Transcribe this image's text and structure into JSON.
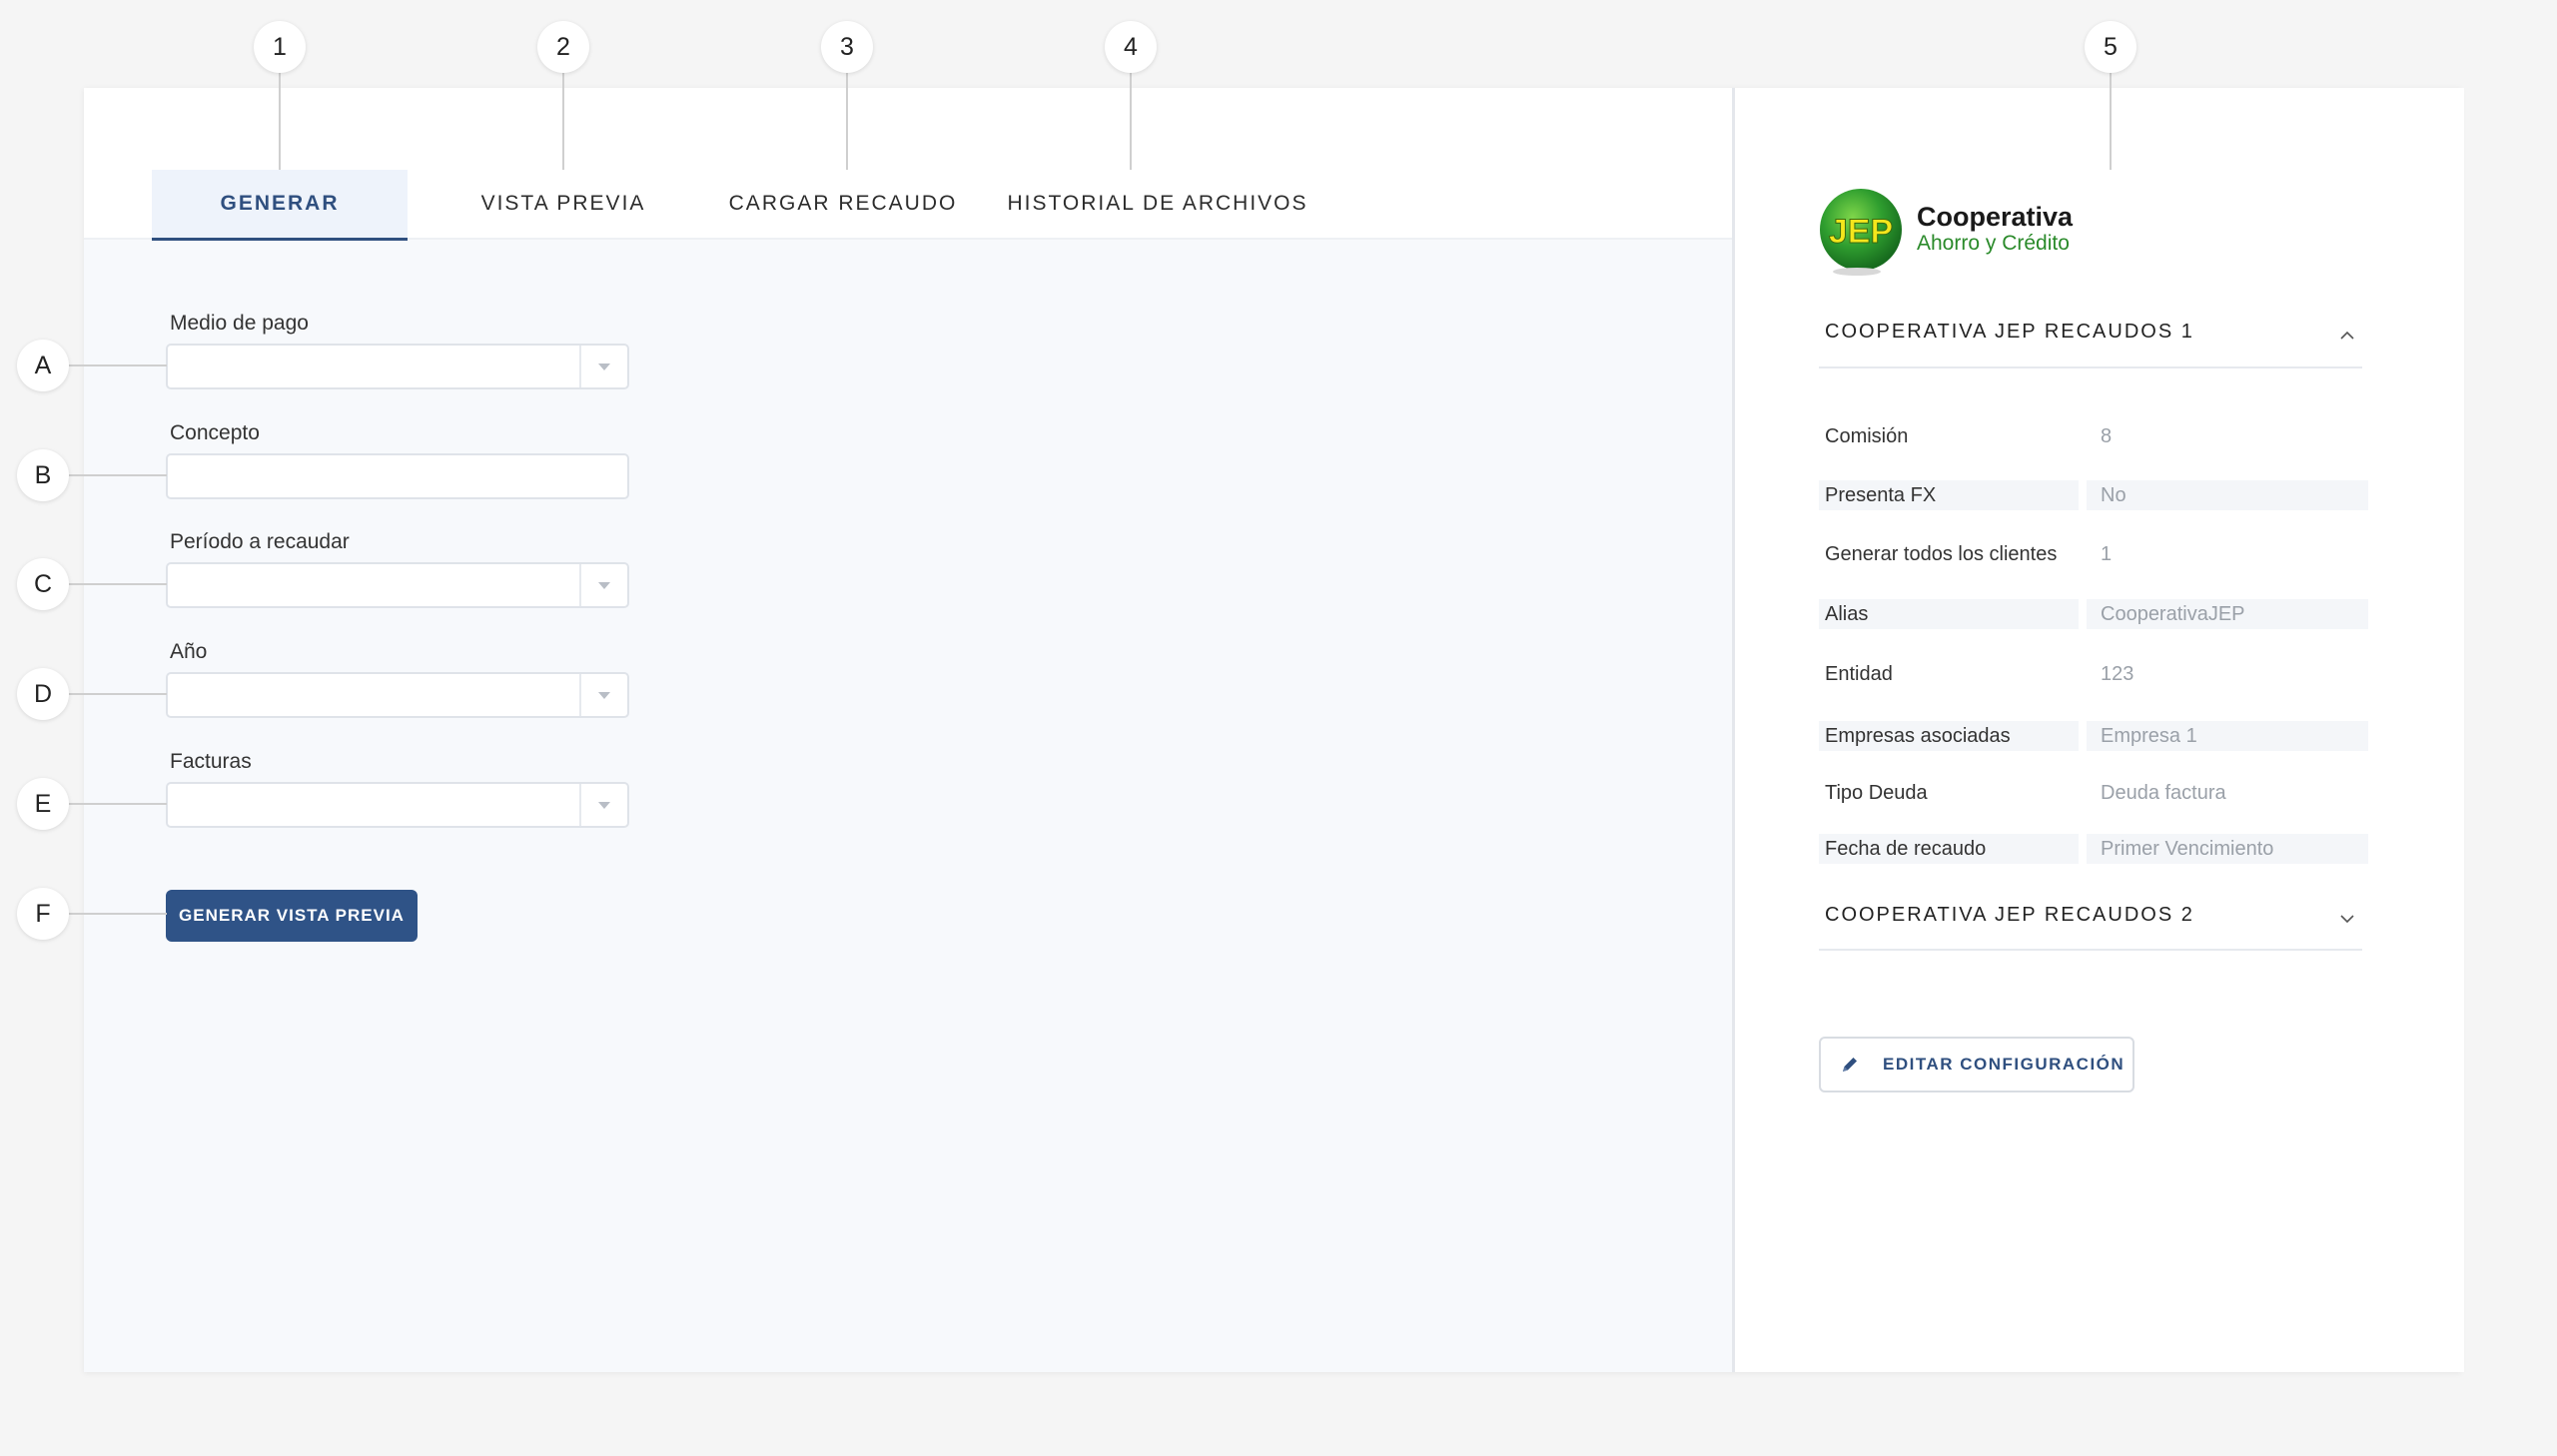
{
  "callouts": {
    "top": [
      "1",
      "2",
      "3",
      "4",
      "5"
    ],
    "left": [
      "A",
      "B",
      "C",
      "D",
      "E",
      "F"
    ]
  },
  "tabs": [
    {
      "label": "GENERAR",
      "active": true
    },
    {
      "label": "VISTA PREVIA",
      "active": false
    },
    {
      "label": "CARGAR RECAUDO",
      "active": false
    },
    {
      "label": "HISTORIAL DE ARCHIVOS",
      "active": false
    }
  ],
  "form": {
    "medio_pago": {
      "label": "Medio de pago",
      "value": ""
    },
    "concepto": {
      "label": "Concepto",
      "value": ""
    },
    "periodo": {
      "label": "Período a recaudar",
      "value": ""
    },
    "anio": {
      "label": "Año",
      "value": ""
    },
    "facturas": {
      "label": "Facturas",
      "value": ""
    },
    "submit_label": "GENERAR VISTA PREVIA"
  },
  "logo": {
    "mark": "JEP",
    "line1": "Cooperativa",
    "line2": "Ahorro y Crédito"
  },
  "config": {
    "section1": {
      "title": "COOPERATIVA JEP RECAUDOS 1",
      "expanded": true,
      "rows": [
        {
          "key": "Comisión",
          "value": "8"
        },
        {
          "key": "Presenta FX",
          "value": "No"
        },
        {
          "key": "Generar todos los clientes",
          "value": "1"
        },
        {
          "key": "Alias",
          "value": "CooperativaJEP"
        },
        {
          "key": "Entidad",
          "value": "123"
        },
        {
          "key": "Empresas asociadas",
          "value": "Empresa 1"
        },
        {
          "key": "Tipo Deuda",
          "value": "Deuda factura"
        },
        {
          "key": "Fecha de recaudo",
          "value": "Primer Vencimiento"
        }
      ]
    },
    "section2": {
      "title": "COOPERATIVA JEP RECAUDOS 2",
      "expanded": false
    },
    "edit_label": "EDITAR CONFIGURACIÓN"
  },
  "colors": {
    "primary": "#2f5387",
    "brand_green": "#3aa83a",
    "brand_yellow": "#f5e61c"
  }
}
